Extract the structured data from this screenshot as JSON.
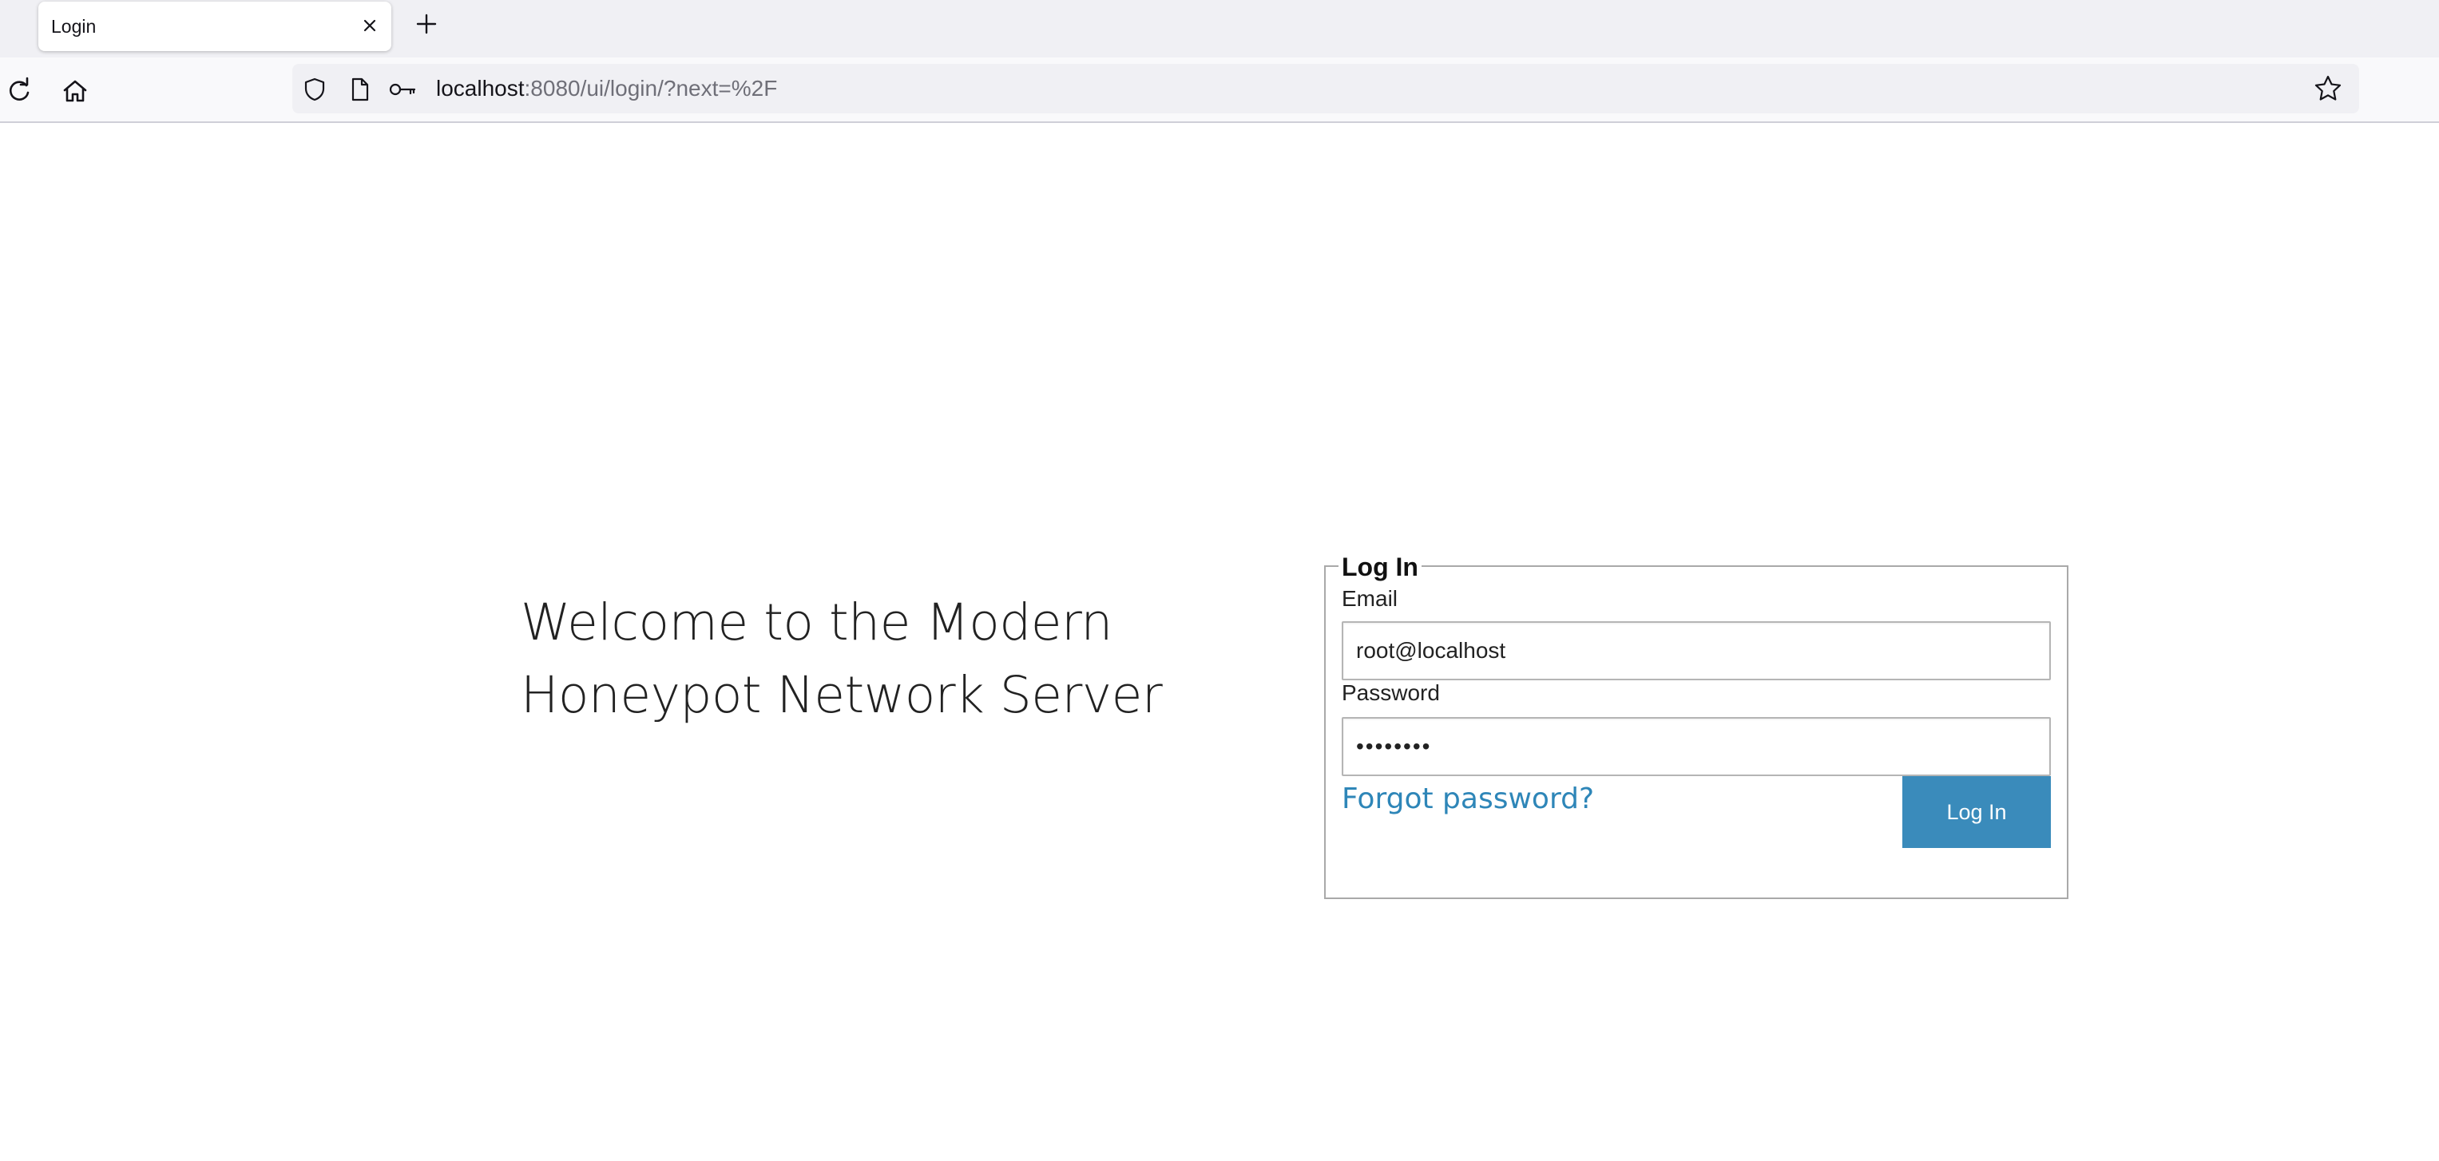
{
  "browser": {
    "tab_title": "Login",
    "url_host": "localhost",
    "url_path": ":8080/ui/login/?next=%2F",
    "icons": {
      "tab_close": "close-icon",
      "new_tab": "plus-icon",
      "reload": "reload-icon",
      "home": "home-icon",
      "tracking": "shield-icon",
      "page": "page-icon",
      "password_manager": "key-icon",
      "bookmark": "star-icon"
    }
  },
  "page": {
    "welcome_line1": "Welcome to the Modern",
    "welcome_line2": "Honeypot Network Server"
  },
  "login": {
    "legend": "Log In",
    "email_label": "Email",
    "email_value": "root@localhost",
    "password_label": "Password",
    "password_value": "password",
    "forgot_link": "Forgot password?",
    "submit_label": "Log In"
  },
  "colors": {
    "accent": "#3a8bbb",
    "link": "#2e86b8",
    "chrome_bg": "#f0f0f4"
  }
}
